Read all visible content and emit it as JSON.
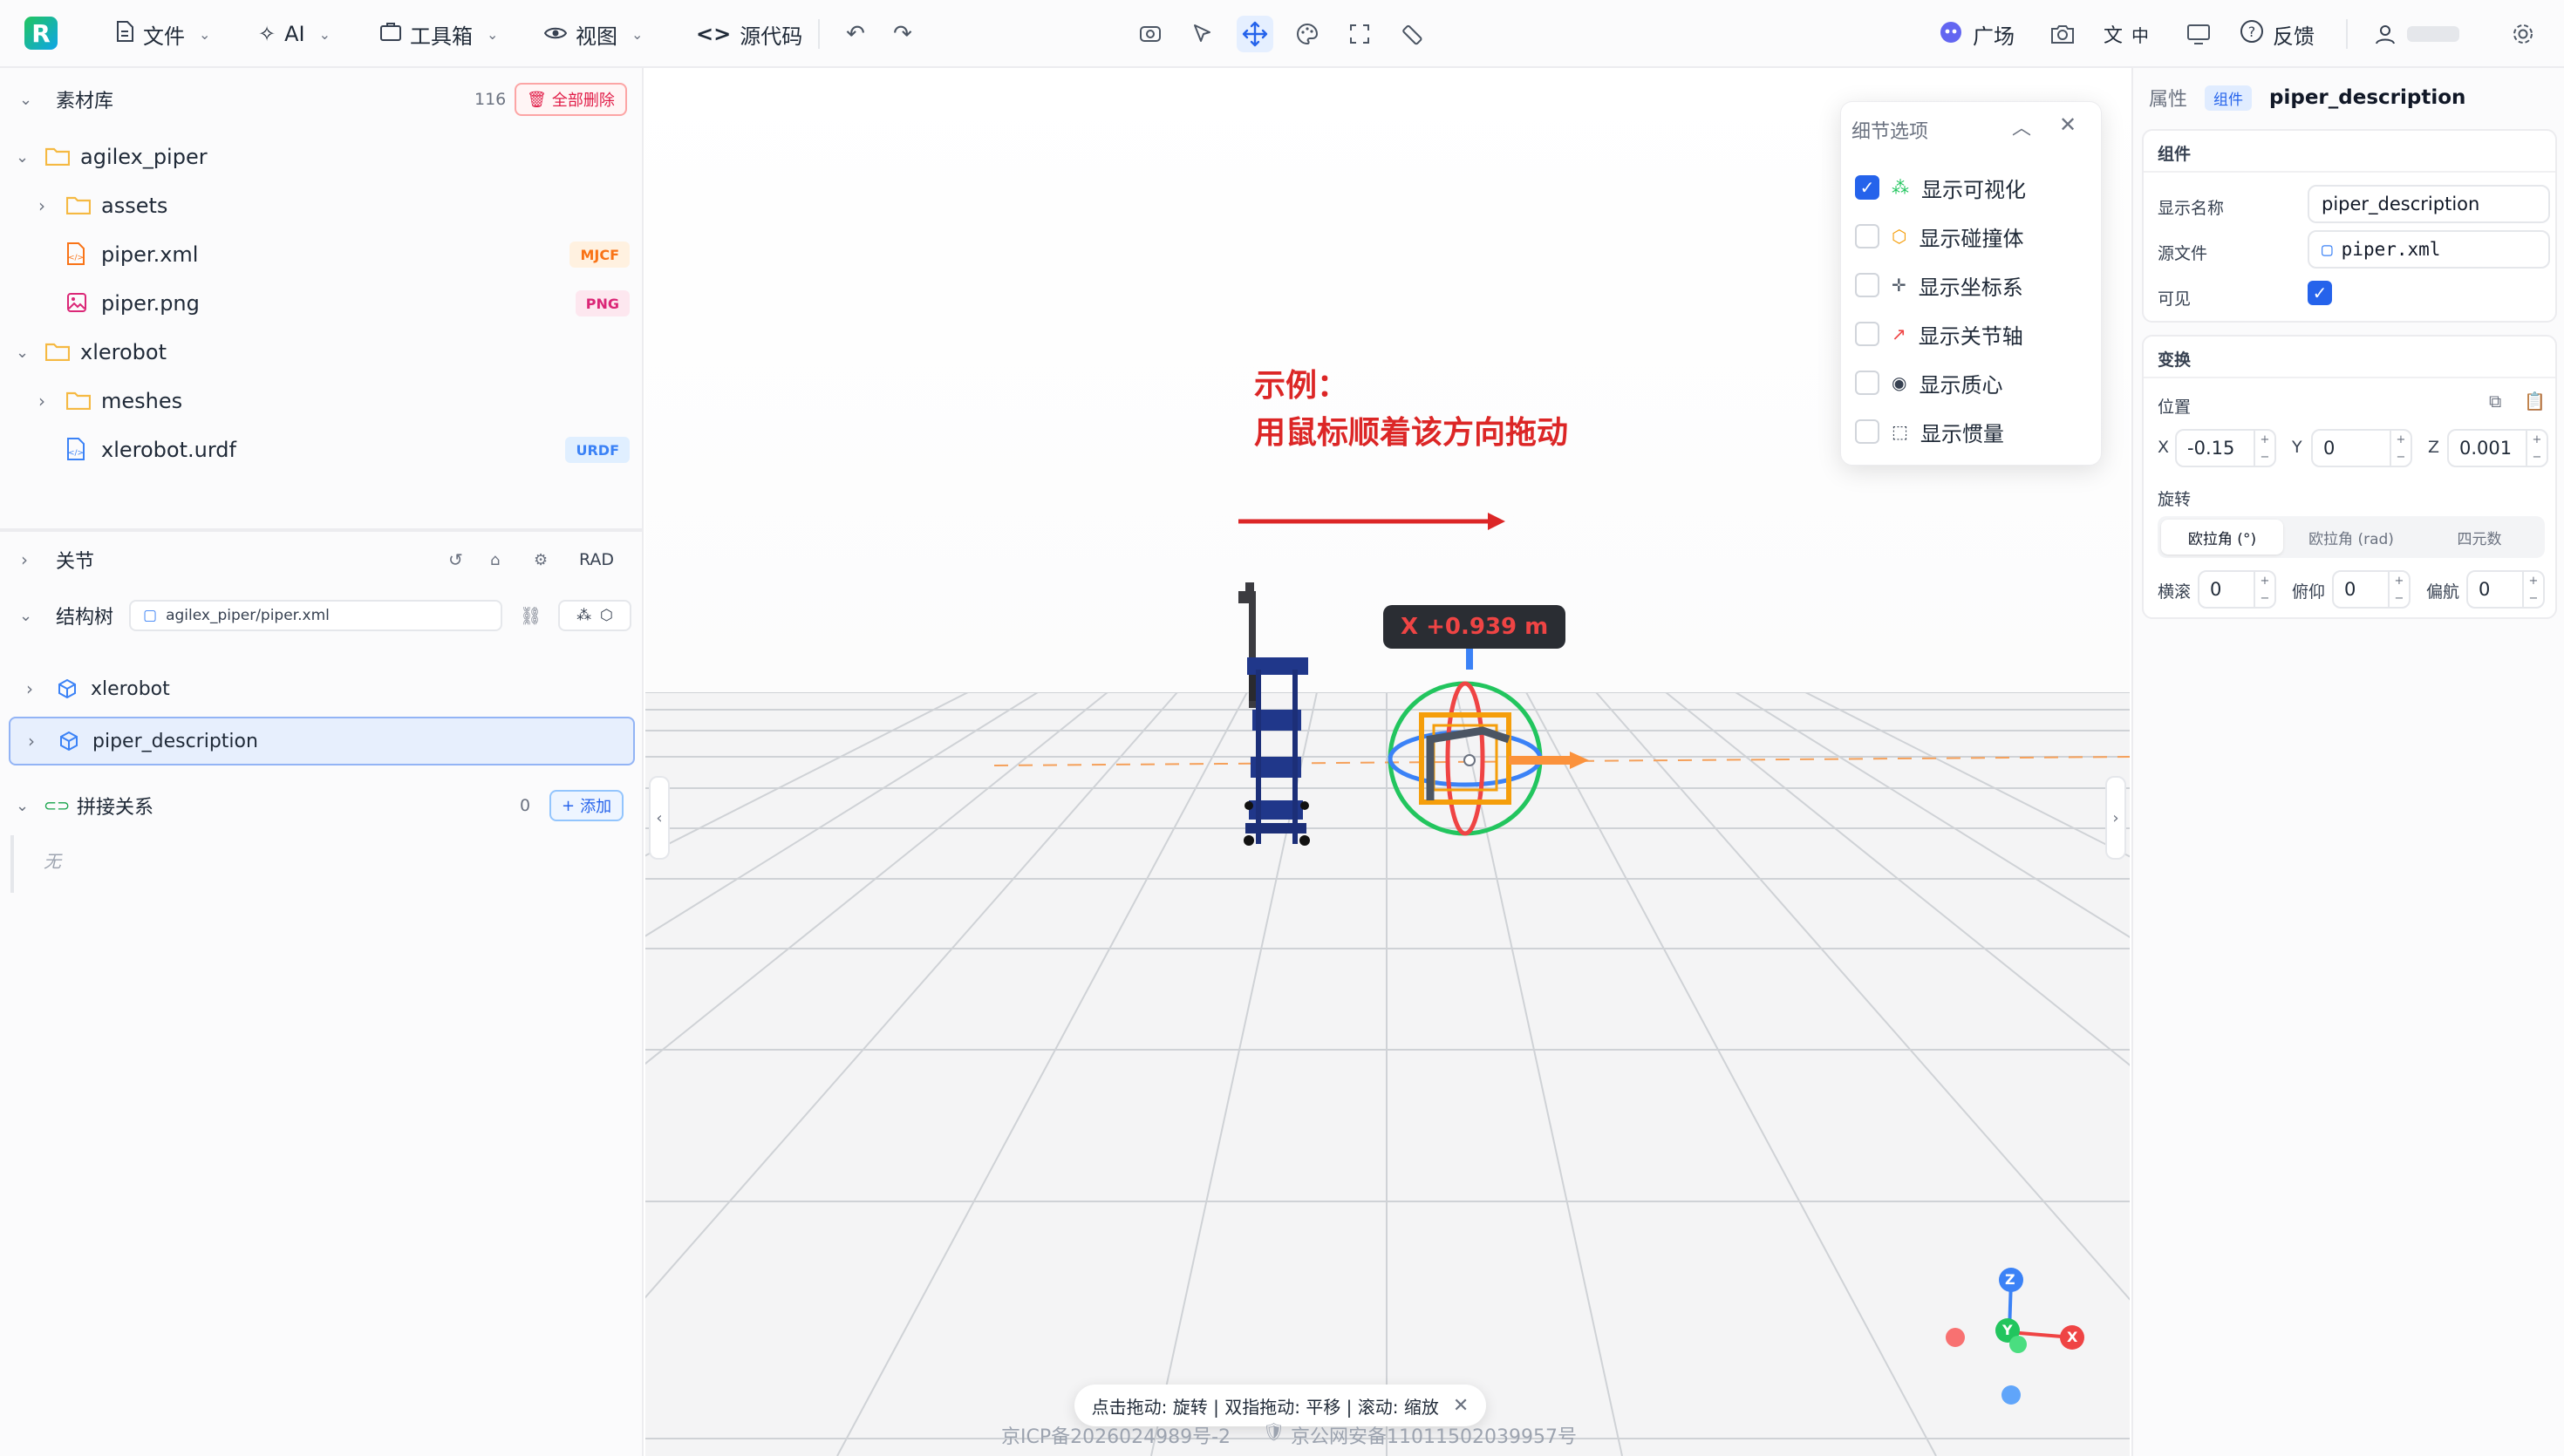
{
  "colors": {
    "accent": "#2563eb",
    "danger": "#e11d48",
    "annotation": "#dc2626",
    "folder": "#f5b942",
    "mjcf": "#f97316",
    "png": "#db2777",
    "urdf": "#3b82f6"
  },
  "topbar": {
    "logo": "R",
    "file_label": "文件",
    "ai_label": "AI",
    "toolbox_label": "工具箱",
    "view_label": "视图",
    "source_label": "源代码",
    "plaza_label": "广场",
    "lang_label": "中",
    "feedback_label": "反馈"
  },
  "library": {
    "title": "素材库",
    "count": "116",
    "delete_all_label": "全部删除",
    "tree": [
      {
        "name": "agilex_piper",
        "type": "folder"
      },
      {
        "name": "assets",
        "type": "folder"
      },
      {
        "name": "piper.xml",
        "type": "file",
        "tag": "MJCF"
      },
      {
        "name": "piper.png",
        "type": "image",
        "tag": "PNG"
      },
      {
        "name": "xlerobot",
        "type": "folder"
      },
      {
        "name": "meshes",
        "type": "folder"
      },
      {
        "name": "xlerobot.urdf",
        "type": "file",
        "tag": "URDF"
      }
    ]
  },
  "joints": {
    "title": "关节",
    "unit_label": "RAD"
  },
  "structure": {
    "title": "结构树",
    "file_path": "agilex_piper/piper.xml",
    "items": [
      {
        "name": "xlerobot"
      },
      {
        "name": "piper_description"
      }
    ]
  },
  "connections": {
    "title": "拼接关系",
    "count": "0",
    "add_label": "添加",
    "empty_text": "无"
  },
  "viewport": {
    "annotation_line1": "示例：",
    "annotation_line2": "用鼠标顺着该方向拖动",
    "drag_readout": "X +0.939 m",
    "axis_labels": {
      "z": "Z",
      "y": "Y",
      "x": "X"
    },
    "hint_text": "点击拖动: 旋转 | 双指拖动: 平移 | 滚动: 缩放",
    "icp_text": "京ICP备2026024989号-2",
    "police_text": "京公网安备11011502039957号"
  },
  "detail_options": {
    "title": "细节选项",
    "items": [
      {
        "label": "显示可视化",
        "checked": true
      },
      {
        "label": "显示碰撞体",
        "checked": false
      },
      {
        "label": "显示坐标系",
        "checked": false
      },
      {
        "label": "显示关节轴",
        "checked": false
      },
      {
        "label": "显示质心",
        "checked": false
      },
      {
        "label": "显示惯量",
        "checked": false
      }
    ]
  },
  "properties": {
    "title": "属性",
    "badge": "组件",
    "name": "piper_description",
    "component_section": "组件",
    "display_name_label": "显示名称",
    "display_name_value": "piper_description",
    "source_file_label": "源文件",
    "source_file_value": "piper.xml",
    "visible_label": "可见",
    "visible": true,
    "transform_section": "变换",
    "position_label": "位置",
    "pos_x_label": "X",
    "pos_x": "-0.15",
    "pos_y_label": "Y",
    "pos_y": "0",
    "pos_z_label": "Z",
    "pos_z": "0.001",
    "rotation_label": "旋转",
    "rotation_tabs": [
      "欧拉角 (°)",
      "欧拉角 (rad)",
      "四元数"
    ],
    "roll_label": "横滚",
    "roll": "0",
    "pitch_label": "俯仰",
    "pitch": "0",
    "yaw_label": "偏航",
    "yaw": "0"
  }
}
